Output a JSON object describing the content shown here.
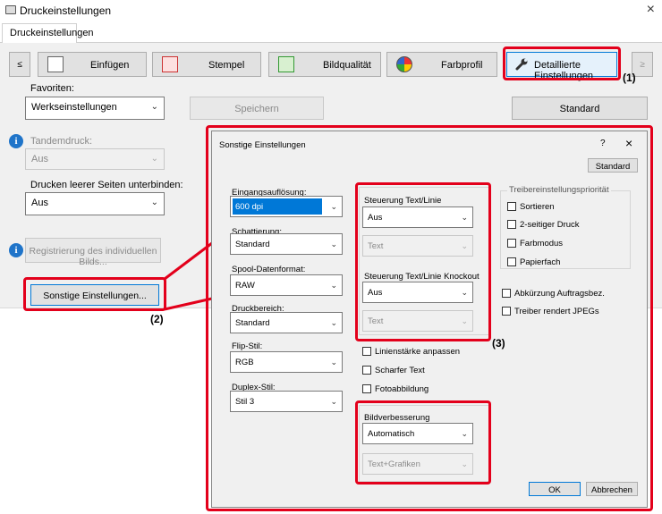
{
  "window": {
    "title": "Druckeinstellungen",
    "close_glyph": "×"
  },
  "tabs": [
    {
      "label": "Druckeinstellungen"
    }
  ],
  "toolbar": {
    "prev_glyph": "≤",
    "next_glyph": "≥",
    "items": [
      {
        "label": "Einfügen",
        "icon": "insert-pages-icon"
      },
      {
        "label": "Stempel",
        "icon": "stamp-icon"
      },
      {
        "label": "Bildqualität",
        "icon": "image-quality-icon"
      },
      {
        "label": "Farbprofil",
        "icon": "color-profile-icon"
      },
      {
        "label": "Detaillierte Einstellungen",
        "icon": "wrench-icon"
      }
    ]
  },
  "favorites": {
    "label": "Favoriten:",
    "value": "Werkseinstellungen",
    "save_label": "Speichern",
    "default_label": "Standard"
  },
  "tandem": {
    "label": "Tandemdruck:",
    "value": "Aus"
  },
  "blank_pages": {
    "label": "Drucken leerer Seiten unterbinden:",
    "value": "Aus"
  },
  "register_button": "Registrierung des individuellen Bilds...",
  "other_settings_button": "Sonstige Einstellungen...",
  "callouts": {
    "c1": "(1)",
    "c2": "(2)",
    "c3": "(3)"
  },
  "dialog": {
    "title": "Sonstige Einstellungen",
    "help_glyph": "?",
    "close_glyph": "×",
    "standard_label": "Standard",
    "left_fields": [
      {
        "label": "Eingangsauflösung:",
        "value": "600 dpi"
      },
      {
        "label": "Schattierung:",
        "value": "Standard"
      },
      {
        "label": "Spool-Datenformat:",
        "value": "RAW"
      },
      {
        "label": "Druckbereich:",
        "value": "Standard"
      },
      {
        "label": "Flip-Stil:",
        "value": "RGB"
      },
      {
        "label": "Duplex-Stil:",
        "value": "Stil 3"
      }
    ],
    "text_line": {
      "label": "Steuerung Text/Linie",
      "value": "Aus",
      "sub_value": "Text"
    },
    "knockout": {
      "label": "Steuerung Text/Linie Knockout",
      "value": "Aus",
      "sub_value": "Text"
    },
    "middle_checks": [
      "Linienstärke anpassen",
      "Scharfer Text",
      "Fotoabbildung"
    ],
    "image_improve": {
      "label": "Bildverbesserung",
      "value": "Automatisch",
      "sub_value": "Text+Grafiken"
    },
    "driver_priority": {
      "label": "Treibereinstellungspriorität",
      "items": [
        "Sortieren",
        "2-seitiger Druck",
        "Farbmodus",
        "Papierfach"
      ]
    },
    "right_checks": [
      "Abkürzung Auftragsbez.",
      "Treiber rendert JPEGs"
    ],
    "ok_label": "OK",
    "cancel_label": "Abbrechen"
  },
  "colors": {
    "callout_red": "#e3001b",
    "highlight_blue": "#0078d7",
    "panel_grey": "#f0f0f0"
  }
}
